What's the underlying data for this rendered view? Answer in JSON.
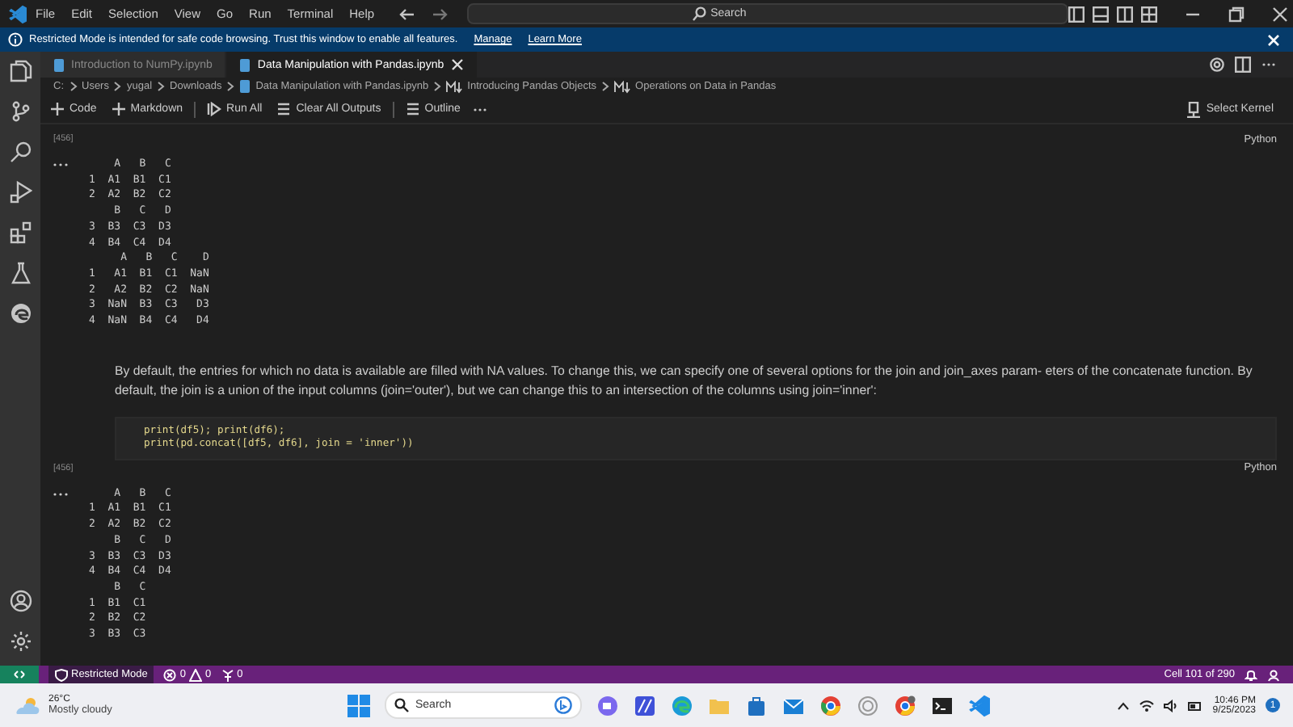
{
  "menu_bar": {
    "items": [
      "File",
      "Edit",
      "Selection",
      "View",
      "Go",
      "Run",
      "Terminal",
      "Help"
    ],
    "search": {
      "placeholder": "Search"
    }
  },
  "banner": {
    "message": "Restricted Mode is intended for safe code browsing. Trust this window to enable all features.",
    "links": [
      "Manage",
      "Learn More"
    ]
  },
  "tabs": [
    {
      "label": "Introduction to NumPy.ipynb",
      "selected": false
    },
    {
      "label": "Data Manipulation with Pandas.ipynb",
      "selected": true
    }
  ],
  "breadcrumb": [
    {
      "kind": "folder",
      "label": "C:"
    },
    {
      "kind": "folder",
      "label": "Users"
    },
    {
      "kind": "folder",
      "label": "yugal"
    },
    {
      "kind": "folder",
      "label": "Downloads"
    },
    {
      "kind": "notebook",
      "label": "Data Manipulation with Pandas.ipynb"
    },
    {
      "kind": "markdown",
      "label": "Introducing Pandas Objects"
    },
    {
      "kind": "markdown",
      "label": "Operations on Data in Pandas"
    }
  ],
  "toolbar": {
    "items": [
      {
        "kind": "add",
        "label": "Code"
      },
      {
        "kind": "add",
        "label": "Markdown"
      },
      {
        "kind": "run",
        "label": "Run All"
      },
      {
        "kind": "clear",
        "label": "Clear All Outputs"
      },
      {
        "kind": "outline",
        "label": "Outline"
      }
    ],
    "kernel": "Select Kernel"
  },
  "cells": [
    {
      "kind": "code",
      "count": "[456]",
      "language": "Python",
      "output": [
        "    A   B   C",
        "1  A1  B1  C1",
        "2  A2  B2  C2",
        "    B   C   D",
        "3  B3  C3  D3",
        "4  B4  C4  D4",
        "     A   B   C    D",
        "1   A1  B1  C1  NaN",
        "2   A2  B2  C2  NaN",
        "3  NaN  B3  C3   D3",
        "4  NaN  B4  C4   D4"
      ]
    },
    {
      "kind": "markdown",
      "text": "By default, the entries for which no data is available are filled with NA values. To change this, we can specify one of several options for the join and join_axes param- eters of the concatenate function. By default, the join is a union of the input columns (join='outer'), but we can change this to an intersection of the columns using join='inner':"
    },
    {
      "kind": "code",
      "code": [
        "print(df5); print(df6);",
        "print(pd.concat([df5, df6], join = 'inner'))"
      ],
      "count": "[456]",
      "language": "Python",
      "output": [
        "    A   B   C",
        "1  A1  B1  C1",
        "2  A2  B2  C2",
        "    B   C   D",
        "3  B3  C3  D3",
        "4  B4  C4  D4",
        "    B   C",
        "1  B1  C1",
        "2  B2  C2",
        "3  B3  C3"
      ]
    }
  ],
  "status_bar": {
    "mode": "Restricted Mode",
    "errors": "0",
    "warnings": "0",
    "ports": "0",
    "cell": "Cell 101 of 290"
  },
  "taskbar": {
    "temperature": "26°C",
    "weather": "Mostly cloudy",
    "search": {
      "placeholder": "Search"
    },
    "time": "10:46 PM",
    "date": "9/25/2023",
    "notifications": "1"
  }
}
